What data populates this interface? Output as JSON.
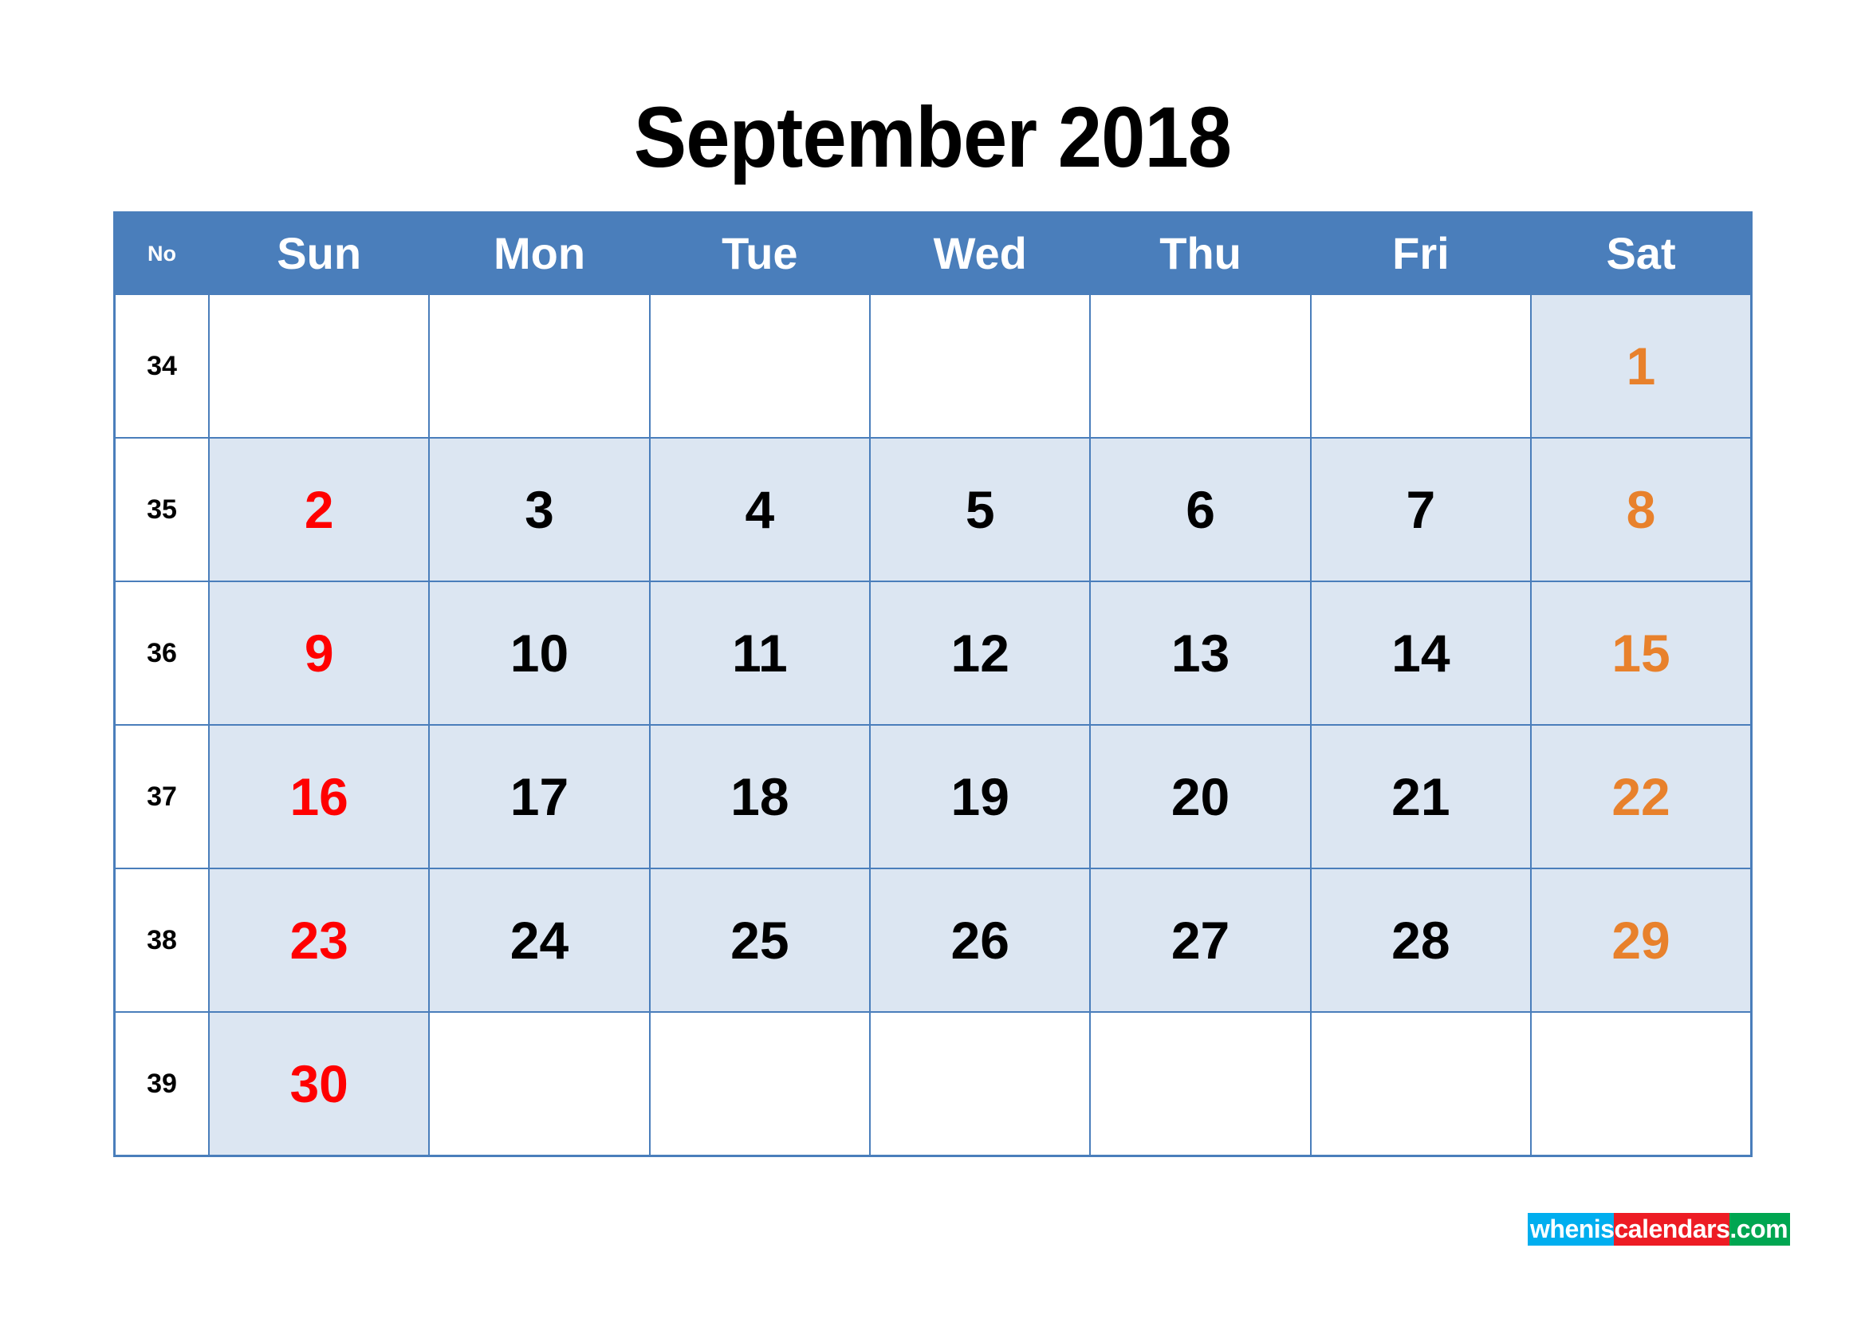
{
  "title": "September 2018",
  "header": {
    "week_col_label": "No",
    "days": [
      "Sun",
      "Mon",
      "Tue",
      "Wed",
      "Thu",
      "Fri",
      "Sat"
    ]
  },
  "colors": {
    "header_bg": "#4A7EBB",
    "grid_line": "#4A7EBB",
    "cell_filled_bg": "#DCE6F2",
    "cell_blank_bg": "#FFFFFF",
    "sunday_text": "#FF0000",
    "saturday_text": "#E8812C",
    "weekday_text": "#000000"
  },
  "weeks": [
    {
      "no": "34",
      "days": [
        {
          "label": "",
          "color": "none",
          "filled": false
        },
        {
          "label": "",
          "color": "none",
          "filled": false
        },
        {
          "label": "",
          "color": "none",
          "filled": false
        },
        {
          "label": "",
          "color": "none",
          "filled": false
        },
        {
          "label": "",
          "color": "none",
          "filled": false
        },
        {
          "label": "",
          "color": "none",
          "filled": false
        },
        {
          "label": "1",
          "color": "orange",
          "filled": true
        }
      ]
    },
    {
      "no": "35",
      "days": [
        {
          "label": "2",
          "color": "red",
          "filled": true
        },
        {
          "label": "3",
          "color": "black",
          "filled": true
        },
        {
          "label": "4",
          "color": "black",
          "filled": true
        },
        {
          "label": "5",
          "color": "black",
          "filled": true
        },
        {
          "label": "6",
          "color": "black",
          "filled": true
        },
        {
          "label": "7",
          "color": "black",
          "filled": true
        },
        {
          "label": "8",
          "color": "orange",
          "filled": true
        }
      ]
    },
    {
      "no": "36",
      "days": [
        {
          "label": "9",
          "color": "red",
          "filled": true
        },
        {
          "label": "10",
          "color": "black",
          "filled": true
        },
        {
          "label": "11",
          "color": "black",
          "filled": true
        },
        {
          "label": "12",
          "color": "black",
          "filled": true
        },
        {
          "label": "13",
          "color": "black",
          "filled": true
        },
        {
          "label": "14",
          "color": "black",
          "filled": true
        },
        {
          "label": "15",
          "color": "orange",
          "filled": true
        }
      ]
    },
    {
      "no": "37",
      "days": [
        {
          "label": "16",
          "color": "red",
          "filled": true
        },
        {
          "label": "17",
          "color": "black",
          "filled": true
        },
        {
          "label": "18",
          "color": "black",
          "filled": true
        },
        {
          "label": "19",
          "color": "black",
          "filled": true
        },
        {
          "label": "20",
          "color": "black",
          "filled": true
        },
        {
          "label": "21",
          "color": "black",
          "filled": true
        },
        {
          "label": "22",
          "color": "orange",
          "filled": true
        }
      ]
    },
    {
      "no": "38",
      "days": [
        {
          "label": "23",
          "color": "red",
          "filled": true
        },
        {
          "label": "24",
          "color": "black",
          "filled": true
        },
        {
          "label": "25",
          "color": "black",
          "filled": true
        },
        {
          "label": "26",
          "color": "black",
          "filled": true
        },
        {
          "label": "27",
          "color": "black",
          "filled": true
        },
        {
          "label": "28",
          "color": "black",
          "filled": true
        },
        {
          "label": "29",
          "color": "orange",
          "filled": true
        }
      ]
    },
    {
      "no": "39",
      "days": [
        {
          "label": "30",
          "color": "red",
          "filled": true
        },
        {
          "label": "",
          "color": "none",
          "filled": false
        },
        {
          "label": "",
          "color": "none",
          "filled": false
        },
        {
          "label": "",
          "color": "none",
          "filled": false
        },
        {
          "label": "",
          "color": "none",
          "filled": false
        },
        {
          "label": "",
          "color": "none",
          "filled": false
        },
        {
          "label": "",
          "color": "none",
          "filled": false
        }
      ]
    }
  ],
  "brand": {
    "part1": "whenis",
    "part2": "calendars",
    "part3": ".com"
  }
}
